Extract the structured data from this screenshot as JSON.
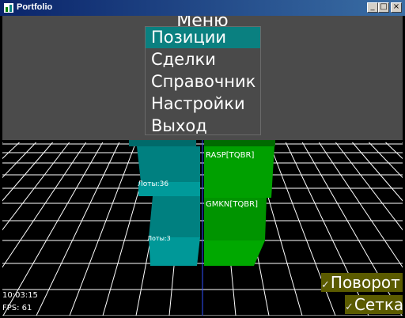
{
  "window": {
    "title": "Portfolio",
    "controls": {
      "minimize": "_",
      "maximize": "□",
      "close": "×"
    }
  },
  "menu": {
    "title": "Меню",
    "items": [
      "Позиции",
      "Сделки",
      "Справочник",
      "Настройки",
      "Выход"
    ],
    "selected_index": 0
  },
  "scene": {
    "bars": [
      {
        "label": "RASP[TQBR]"
      },
      {
        "label": "GMKN[TQBR]"
      }
    ],
    "cyan_labels": [
      "Лоты:36",
      "Лоты:3"
    ]
  },
  "status": {
    "time": "10:03:15",
    "fps": "FPS: 61"
  },
  "toggles": {
    "rotate": "Поворот",
    "grid": "Сетка",
    "check_glyph": "✓"
  },
  "colors": {
    "grid": "#ffffff",
    "green": "#00a000",
    "cyan": "#008c8c",
    "accent": "#0a8080",
    "toggle_bg": "#5b5b00"
  }
}
